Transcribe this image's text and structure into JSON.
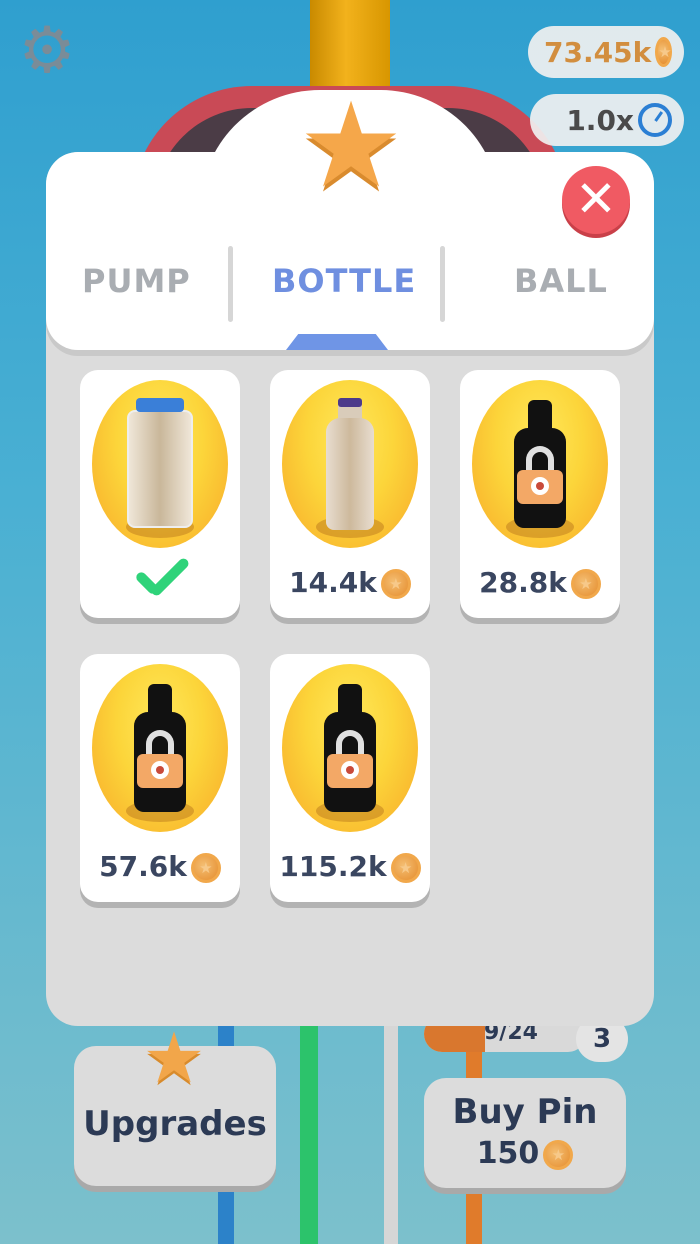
{
  "hud": {
    "coins": "73.45k",
    "speed": "1.0x",
    "settings_icon": "gear-icon"
  },
  "modal": {
    "icon": "star-icon",
    "tabs": [
      {
        "label": "PUMP",
        "active": false
      },
      {
        "label": "BOTTLE",
        "active": true
      },
      {
        "label": "BALL",
        "active": false
      }
    ],
    "items": [
      {
        "kind": "jar",
        "state": "selected",
        "price": ""
      },
      {
        "kind": "milk-bottle",
        "state": "unlocked",
        "price": "14.4k"
      },
      {
        "kind": "soda-bottle",
        "state": "locked",
        "price": "28.8k"
      },
      {
        "kind": "round-bottle",
        "state": "locked",
        "price": "57.6k"
      },
      {
        "kind": "round-bottle",
        "state": "locked",
        "price": "115.2k"
      }
    ]
  },
  "bottom": {
    "upgrades_label": "Upgrades",
    "progress_text": "9/24",
    "progress_fraction": 0.375,
    "level": "3",
    "buy_label": "Buy Pin",
    "buy_price": "150"
  },
  "colors": {
    "accent_tab": "#6f8fe0",
    "close": "#f05a63",
    "coin_text": "#d28e3f"
  }
}
